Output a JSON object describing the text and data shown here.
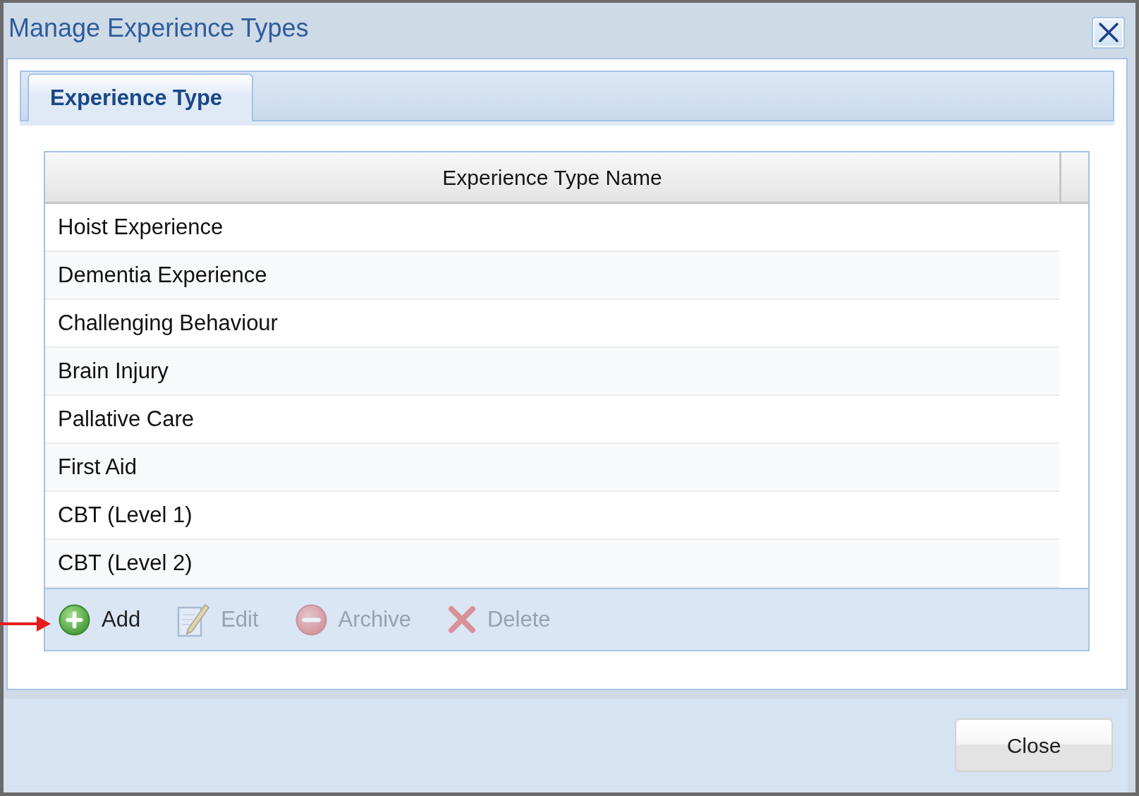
{
  "window": {
    "title": "Manage Experience Types"
  },
  "tabs": [
    {
      "label": "Experience Type",
      "selected": true
    }
  ],
  "table": {
    "columns": [
      "Experience Type Name"
    ],
    "rows": [
      [
        "Hoist Experience"
      ],
      [
        "Dementia Experience"
      ],
      [
        "Challenging Behaviour"
      ],
      [
        "Brain Injury"
      ],
      [
        "Pallative Care"
      ],
      [
        "First Aid"
      ],
      [
        "CBT (Level 1)"
      ],
      [
        "CBT (Level 2)"
      ]
    ]
  },
  "toolbar": {
    "buttons": [
      {
        "kind": "add",
        "label": "Add",
        "disabled": false
      },
      {
        "kind": "edit",
        "label": "Edit",
        "disabled": true
      },
      {
        "kind": "archive",
        "label": "Archive",
        "disabled": true
      },
      {
        "kind": "delete",
        "label": "Delete",
        "disabled": true
      }
    ]
  },
  "footer": {
    "buttons": [
      "Close"
    ]
  }
}
